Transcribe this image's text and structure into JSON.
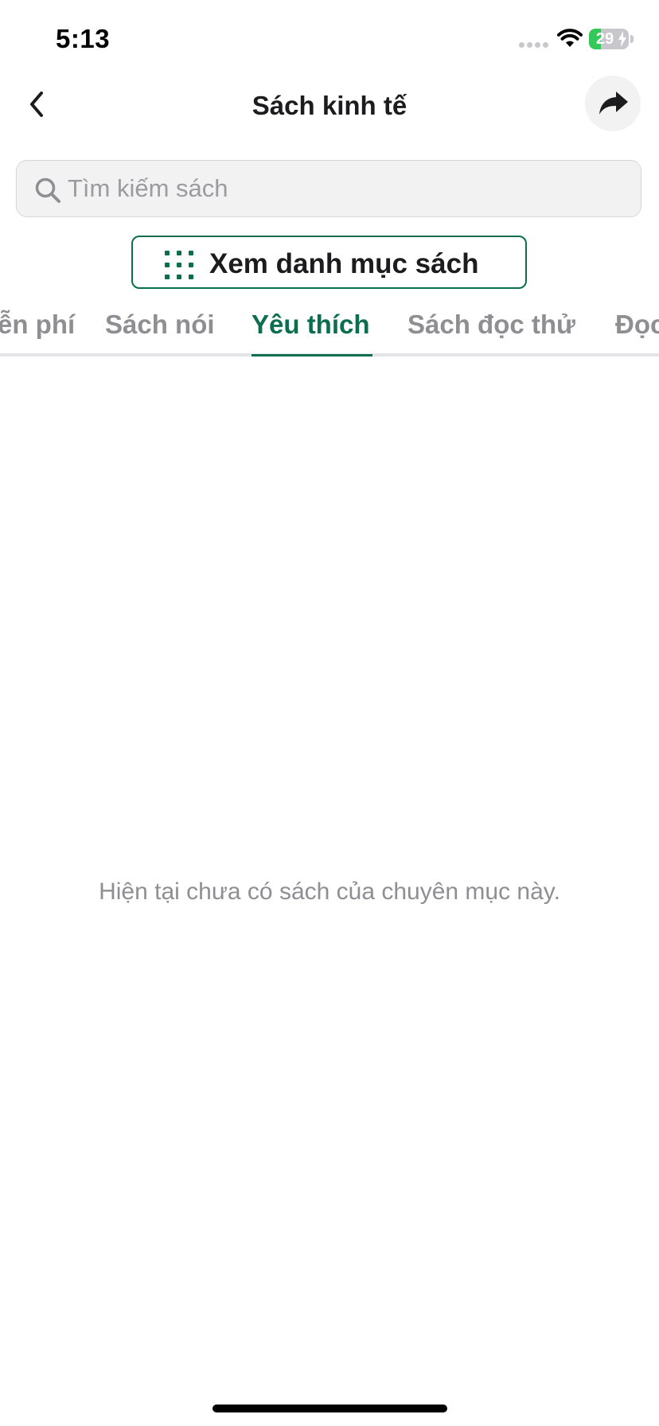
{
  "status_bar": {
    "time": "5:13",
    "battery_level": "29",
    "battery_charge_fraction": 0.29,
    "icons": [
      "signal-icon",
      "wifi-icon",
      "battery-icon",
      "charging-bolt-icon"
    ]
  },
  "header": {
    "title": "Sách kinh tế",
    "icons": [
      "chevron-left-icon",
      "share-arrow-icon"
    ]
  },
  "search": {
    "placeholder": "Tìm kiếm sách",
    "value": "",
    "icon": "search-icon"
  },
  "category_button": {
    "label": "Xem danh mục sách",
    "icon": "grid-icon"
  },
  "tabs": [
    {
      "label": "Miễn phí",
      "visible_text": "ễn phí",
      "active": false
    },
    {
      "label": "Sách nói",
      "active": false
    },
    {
      "label": "Yêu thích",
      "active": true
    },
    {
      "label": "Sách đọc thử",
      "active": false
    },
    {
      "label": "Đọc",
      "active": false
    }
  ],
  "empty_state": {
    "message": "Hiện tại chưa có sách của chuyên mục này."
  },
  "colors": {
    "accent": "#0b6e4f",
    "inactive_tab": "#8e8e93",
    "search_background": "#f2f2f3",
    "battery_green": "#34c759"
  }
}
